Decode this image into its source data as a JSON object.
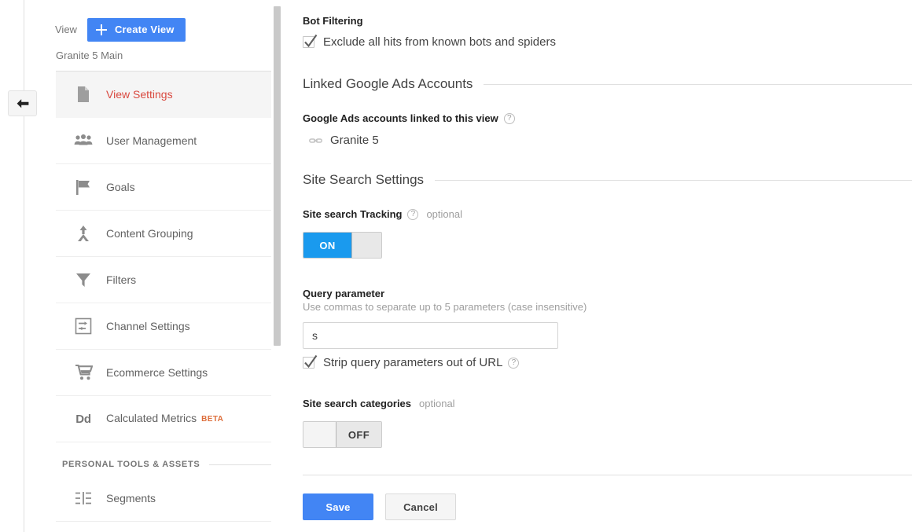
{
  "sidebar": {
    "view_label": "View",
    "create_view_button": "Create View",
    "view_name": "Granite 5 Main",
    "items": [
      {
        "label": "View Settings",
        "icon": "document-icon",
        "active": true
      },
      {
        "label": "User Management",
        "icon": "people-icon",
        "active": false
      },
      {
        "label": "Goals",
        "icon": "flag-icon",
        "active": false
      },
      {
        "label": "Content Grouping",
        "icon": "content-grouping-icon",
        "active": false
      },
      {
        "label": "Filters",
        "icon": "funnel-icon",
        "active": false
      },
      {
        "label": "Channel Settings",
        "icon": "channel-settings-icon",
        "active": false
      },
      {
        "label": "Ecommerce Settings",
        "icon": "shopping-cart-icon",
        "active": false
      },
      {
        "label": "Calculated Metrics",
        "icon": "dd-icon",
        "badge": "BETA",
        "active": false
      }
    ],
    "section_label": "PERSONAL TOOLS & ASSETS",
    "personal_items": [
      {
        "label": "Segments",
        "icon": "segments-icon"
      }
    ]
  },
  "main": {
    "bot_filtering": {
      "title": "Bot Filtering",
      "checkbox_label": "Exclude all hits from known bots and spiders",
      "checked": true
    },
    "linked_ads": {
      "section_title": "Linked Google Ads Accounts",
      "field_label": "Google Ads accounts linked to this view",
      "help": "?",
      "accounts": [
        {
          "name": "Granite 5"
        }
      ]
    },
    "site_search": {
      "section_title": "Site Search Settings",
      "tracking_label": "Site search Tracking",
      "tracking_help": "?",
      "tracking_optional": "optional",
      "tracking_toggle_on_text": "ON",
      "tracking_toggle_off_text": "",
      "tracking_state": "ON",
      "query_param_title": "Query parameter",
      "query_param_hint": "Use commas to separate up to 5 parameters (case insensitive)",
      "query_param_value": "s",
      "query_param_placeholder": "",
      "strip_label": "Strip query parameters out of URL",
      "strip_help": "?",
      "strip_checked": true,
      "categories_label": "Site search categories",
      "categories_optional": "optional",
      "categories_toggle_text": "OFF",
      "categories_state": "OFF"
    },
    "footer": {
      "save_label": "Save",
      "cancel_label": "Cancel"
    }
  },
  "colors": {
    "accent_blue": "#4285f4",
    "toggle_blue": "#1a9aee",
    "active_red": "#d9493f",
    "beta_orange": "#dd6d3a"
  }
}
